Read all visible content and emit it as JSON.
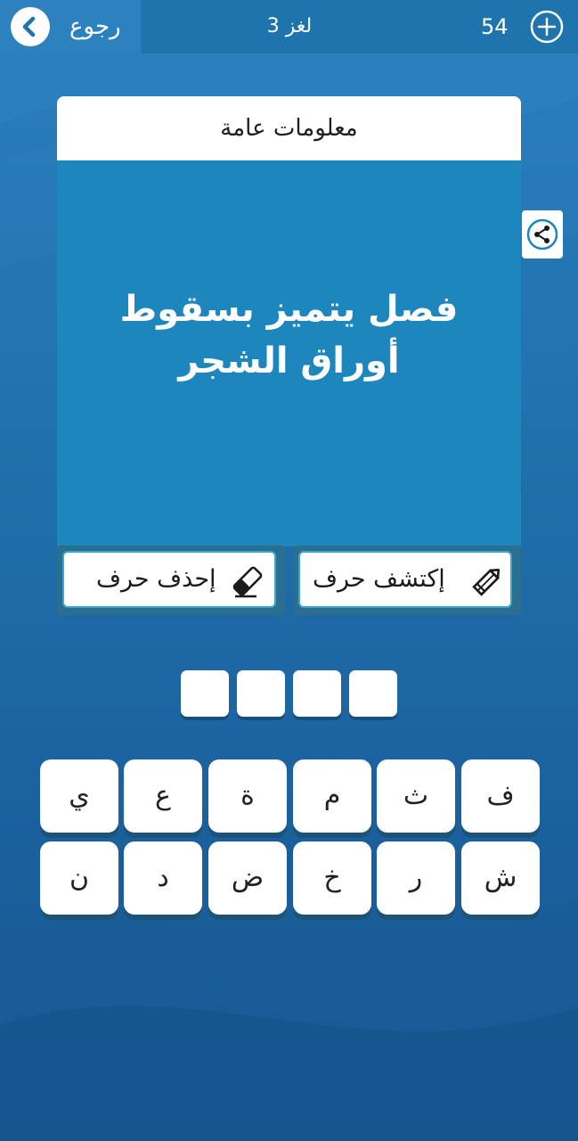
{
  "header": {
    "back_label": "رجوع",
    "level_label": "لغز 3",
    "coins": "54"
  },
  "question": {
    "category": "معلومات عامة",
    "text": "فصل يتميز بسقوط أوراق الشجر"
  },
  "helpers": {
    "reveal_label": "إكتشف حرف",
    "remove_label": "إحذف حرف"
  },
  "answer": {
    "slots": [
      "",
      "",
      "",
      ""
    ]
  },
  "keyboard": {
    "row1": [
      "ف",
      "ث",
      "م",
      "ة",
      "ع",
      "ي"
    ],
    "row2": [
      "ش",
      "ر",
      "خ",
      "ض",
      "د",
      "ن"
    ]
  },
  "icons": {
    "back": "chevron-left-icon",
    "coins": "plus-circle-icon",
    "share": "share-icon",
    "reveal": "pencil-icon",
    "remove": "eraser-icon"
  },
  "colors": {
    "background": "#1f6eaa",
    "card": "#1d86bd",
    "header_bar": "#1e74ad",
    "white": "#ffffff"
  }
}
